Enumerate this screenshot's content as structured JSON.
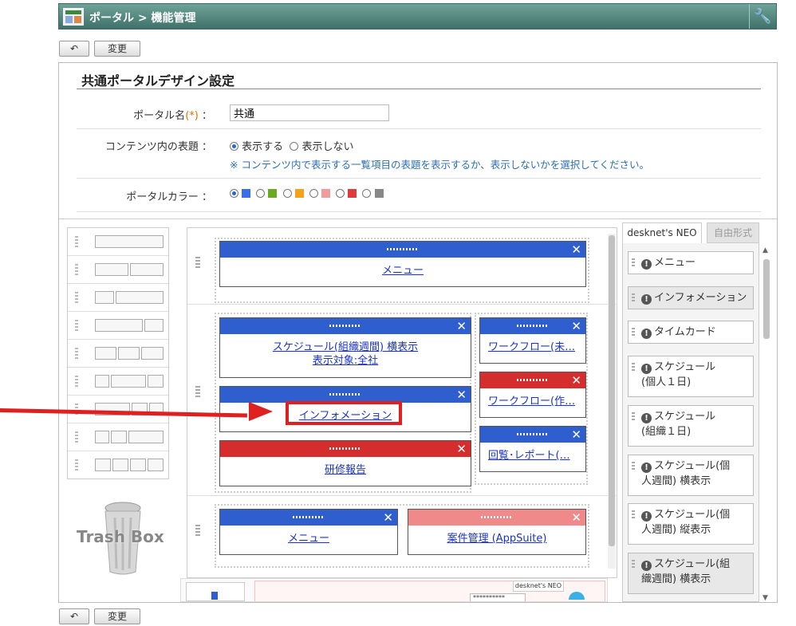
{
  "header": {
    "title": "ポータル > 機能管理",
    "icon": "portal-icon",
    "tool_icon": "wrench-icon"
  },
  "toolbar": {
    "back_icon": "back-arrow-icon",
    "change_label": "変更"
  },
  "section": {
    "title": "共通ポータルデザイン設定"
  },
  "form": {
    "name_label": "ポータル名",
    "required_mark": "(*)",
    "colon": "：",
    "name_value": "共通",
    "heading_label": "コンテンツ内の表題",
    "heading_show": "表示する",
    "heading_hide": "表示しない",
    "heading_note": "※ コンテンツ内で表示する一覧項目の表題を表示するか、表示しないかを選択してください。",
    "color_label": "ポータルカラー",
    "colors": [
      "#3a6ee8",
      "#6aaa1e",
      "#f4a21a",
      "#f29b9b",
      "#e03a3a",
      "#888888"
    ]
  },
  "trash": {
    "label": "Trash Box"
  },
  "canvas": {
    "row1": {
      "w1": "メニュー"
    },
    "row2": {
      "w1_line1": "スケジュール(組織週間) 横表示",
      "w1_line2": "表示対象:全社",
      "w2": "インフォメーション",
      "w3": "研修報告",
      "w4": "ワークフロー(未…",
      "w5": "ワークフロー(作…",
      "w6": "回覧･レポート(…"
    },
    "row3": {
      "w1": "メニュー",
      "w2": "案件管理 (AppSuite)"
    },
    "close": "✕",
    "preview_tab": "desknet's NEO",
    "preview_item": "**********"
  },
  "parts": {
    "tabs": [
      "desknet's NEO",
      "自由形式"
    ],
    "items": [
      "メニュー",
      "インフォメーション",
      "タイムカード",
      "スケジュール(個人１日)",
      "スケジュール(組織１日)",
      "スケジュール(個人週間) 横表示",
      "スケジュール(個人週間) 縦表示",
      "スケジュール(組織週間) 横表示"
    ]
  }
}
